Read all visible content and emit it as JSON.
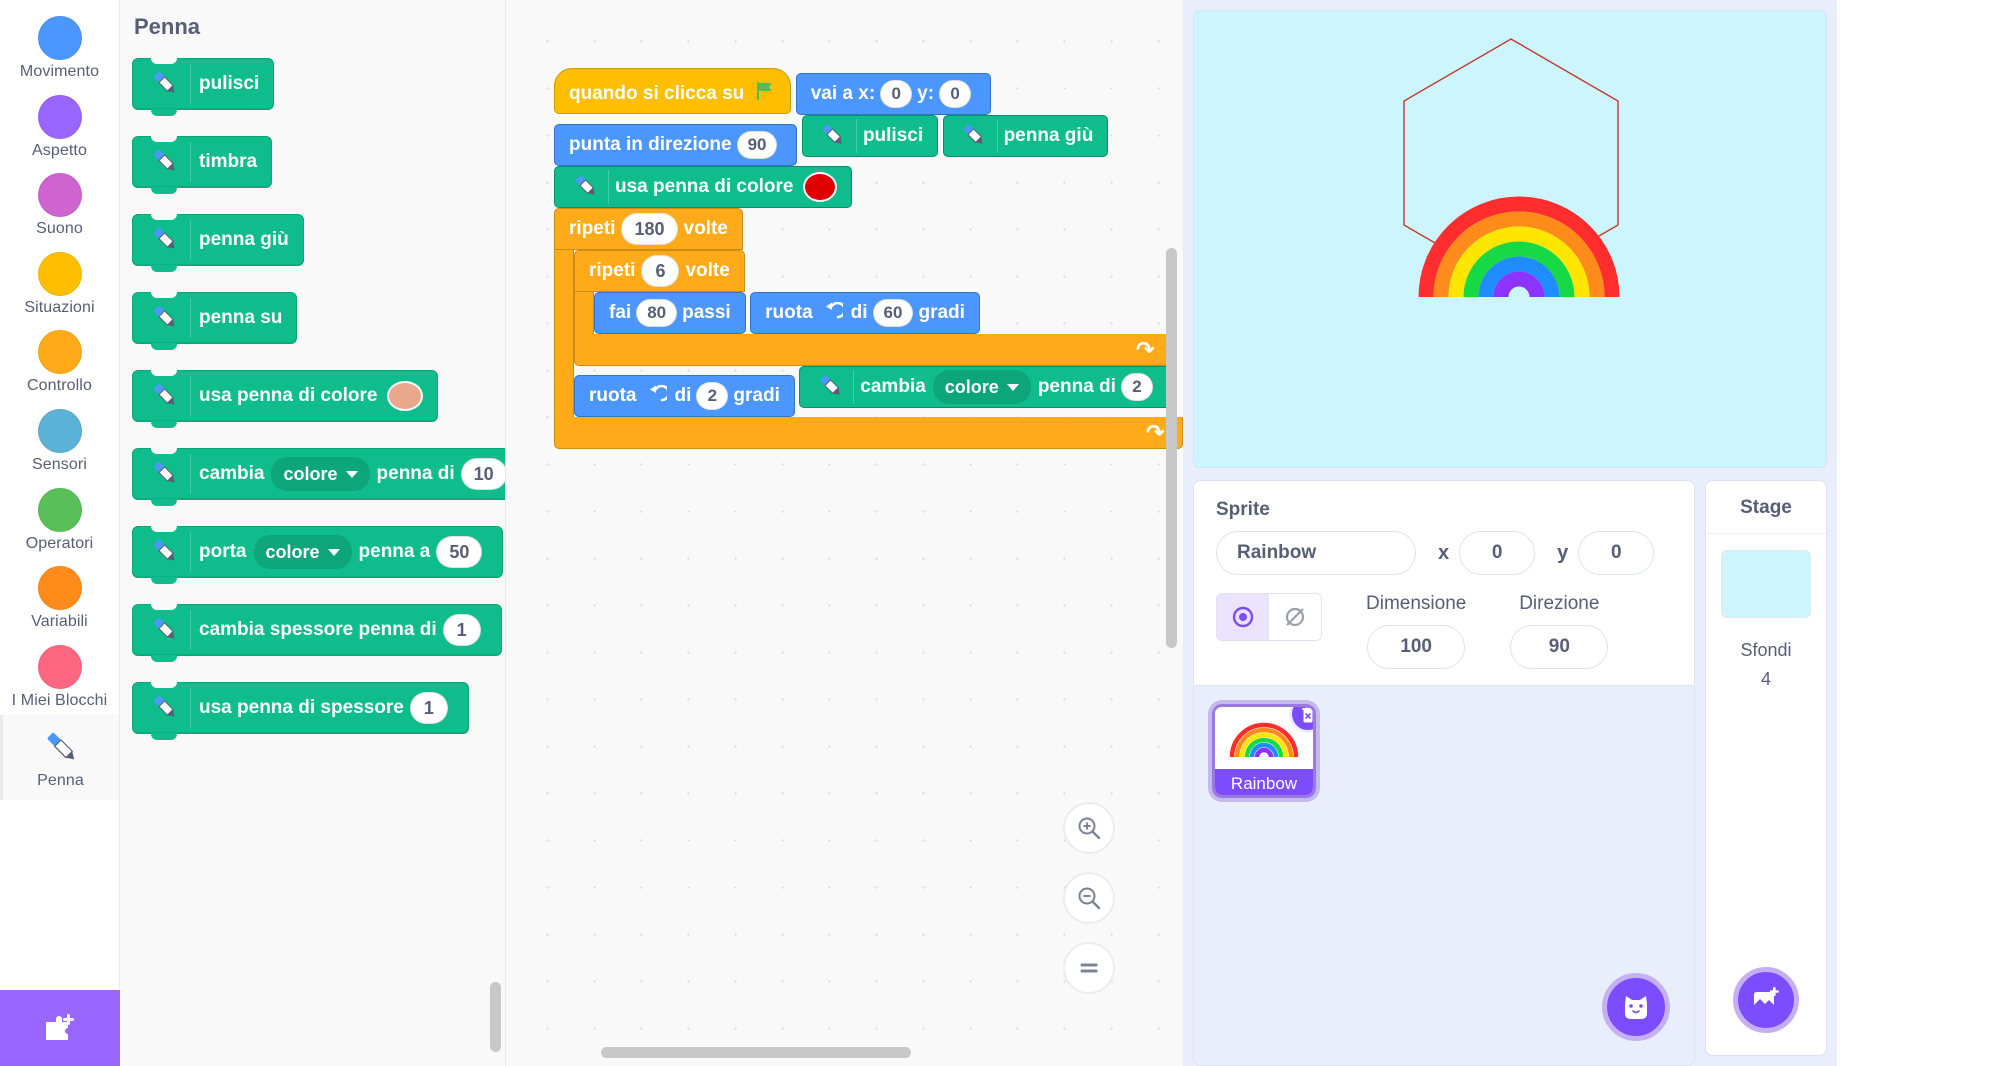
{
  "categories": [
    {
      "label": "Movimento",
      "color": "#4c97ff",
      "name": "movimento"
    },
    {
      "label": "Aspetto",
      "color": "#9966ff",
      "name": "aspetto"
    },
    {
      "label": "Suono",
      "color": "#cf63cf",
      "name": "suono"
    },
    {
      "label": "Situazioni",
      "color": "#ffbf00",
      "name": "situazioni"
    },
    {
      "label": "Controllo",
      "color": "#ffab19",
      "name": "controllo"
    },
    {
      "label": "Sensori",
      "color": "#5cb1d6",
      "name": "sensori"
    },
    {
      "label": "Operatori",
      "color": "#59c059",
      "name": "operatori"
    },
    {
      "label": "Variabili",
      "color": "#ff8c1a",
      "name": "variabili"
    },
    {
      "label": "I Miei Blocchi",
      "color": "#ff6680",
      "name": "i-miei-blocchi"
    }
  ],
  "pen_category": {
    "label": "Penna",
    "selected": true
  },
  "add_extension": {
    "label": "add-extension"
  },
  "palette": {
    "title": "Penna",
    "blocks": [
      {
        "text": "pulisci",
        "type": "pen"
      },
      {
        "text": "timbra",
        "type": "pen"
      },
      {
        "text": "penna giù",
        "type": "pen"
      },
      {
        "text": "penna su",
        "type": "pen"
      },
      {
        "text": "usa penna di colore",
        "type": "pen-color",
        "color": "#e8a88c"
      },
      {
        "pre": "cambia",
        "dropdown": "colore",
        "mid": "penna di",
        "value": "10",
        "type": "pen-dd"
      },
      {
        "pre": "porta",
        "dropdown": "colore",
        "mid": "penna a",
        "value": "50",
        "type": "pen-dd"
      },
      {
        "pre": "cambia spessore penna di",
        "value": "1",
        "type": "pen-num"
      },
      {
        "pre": "usa penna di spessore",
        "value": "1",
        "type": "pen-num"
      }
    ]
  },
  "script": {
    "hat": {
      "text": "quando si clicca su",
      "icon": "green-flag-icon"
    },
    "goto": {
      "label_x": "vai a x:",
      "x": "0",
      "label_y": "y:",
      "y": "0"
    },
    "point": {
      "label": "punta in direzione",
      "value": "90"
    },
    "clear": {
      "text": "pulisci"
    },
    "pen_down": {
      "text": "penna giù"
    },
    "pen_color": {
      "text": "usa penna di colore",
      "color": "#e00000"
    },
    "repeat_outer": {
      "pre": "ripeti",
      "value": "180",
      "post": "volte"
    },
    "repeat_inner": {
      "pre": "ripeti",
      "value": "6",
      "post": "volte"
    },
    "move": {
      "pre": "fai",
      "value": "80",
      "post": "passi"
    },
    "turn_inner": {
      "pre": "ruota",
      "icon": "turn-left-icon",
      "mid": "di",
      "value": "60",
      "post": "gradi"
    },
    "turn_outer": {
      "pre": "ruota",
      "icon": "turn-left-icon",
      "mid": "di",
      "value": "2",
      "post": "gradi"
    },
    "change_color": {
      "pre": "cambia",
      "dropdown": "colore",
      "mid": "penna di",
      "value": "2"
    }
  },
  "zoom_controls": {
    "zoom_in": "zoom-in-icon",
    "zoom_out": "zoom-out-icon",
    "zoom_reset": "zoom-reset-icon"
  },
  "sprite_info": {
    "title": "Sprite",
    "name_value": "Rainbow",
    "name_placeholder": "Rainbow",
    "x_label": "x",
    "x_value": "0",
    "y_label": "y",
    "y_value": "0",
    "size_label": "Dimensione",
    "size_value": "100",
    "direction_label": "Direzione",
    "direction_value": "90",
    "show_icon": "eye-icon",
    "hide_icon": "eye-slash-icon"
  },
  "sprite_list": {
    "items": [
      {
        "name": "Rainbow",
        "selected": true
      }
    ],
    "delete_icon": "trash-icon",
    "add_sprite_icon": "cat-add-icon"
  },
  "stage_panel": {
    "title": "Stage",
    "backdrops_label": "Sfondi",
    "backdrops_count": "4",
    "add_backdrop_icon": "image-add-icon"
  },
  "stage": {
    "background_color": "#ccf5fd",
    "pen_trail_color": "#c0392b",
    "drawing": "hexagon-outline"
  }
}
